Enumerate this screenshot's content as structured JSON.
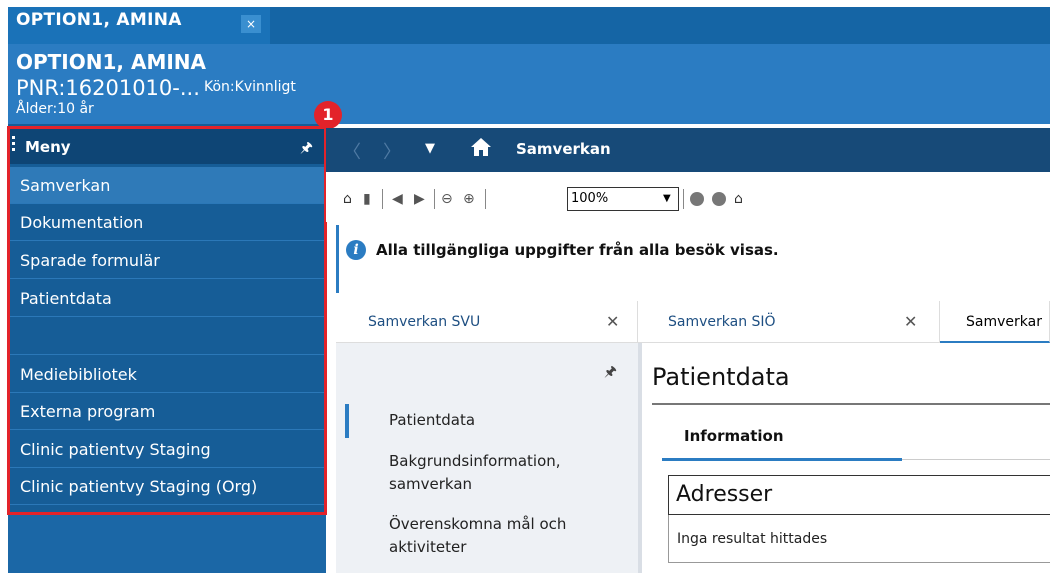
{
  "window": {
    "tab_title": "OPTION1, AMINA",
    "tab_close": "×"
  },
  "patient": {
    "name": "OPTION1, AMINA",
    "pnr": "PNR:16201010-...",
    "gender": "Kön:Kvinnligt",
    "age": "Ålder:10 år"
  },
  "annotation": {
    "badge": "1",
    "color": "#e3232a"
  },
  "menu": {
    "title": "Meny",
    "items": [
      {
        "label": "Samverkan",
        "selected": true
      },
      {
        "label": "Dokumentation"
      },
      {
        "label": "Sparade formulär"
      },
      {
        "label": "Patientdata"
      },
      {
        "label": ""
      },
      {
        "label": "Mediebibliotek"
      },
      {
        "label": "Externa program"
      },
      {
        "label": "Clinic patientvy Staging"
      },
      {
        "label": "Clinic patientvy Staging (Org)"
      }
    ]
  },
  "nav": {
    "title": "Samverkan",
    "icons": [
      "back-icon",
      "forward-icon",
      "dropdown-icon",
      "home-icon"
    ]
  },
  "toolbar": {
    "zoom": "100%",
    "icons": [
      "binoculars-icon",
      "page-icon",
      "prev-page-icon",
      "next-page-icon",
      "zoom-out-icon",
      "zoom-in-icon",
      "circle-icon",
      "circle-icon",
      "home-icon"
    ]
  },
  "info_banner": {
    "text": "Alla tillgängliga uppgifter från alla besök visas."
  },
  "tabs": [
    {
      "label": "Samverkan SVU",
      "close": "✕"
    },
    {
      "label": "Samverkan SIÖ",
      "close": "✕"
    },
    {
      "label": "Samverkar",
      "active": true
    }
  ],
  "nav_panel": {
    "items": [
      "Patientdata",
      "Bakgrundsinformation,",
      "samverkan",
      "Överenskomna mål och",
      "aktiviteter"
    ]
  },
  "patientdata": {
    "title": "Patientdata",
    "tab": "Information",
    "section_title": "Adresser",
    "empty_text": "Inga resultat hittades"
  },
  "colors": {
    "header": "#2b7cc2",
    "sidebar": "#165d97",
    "accent": "#2b7cc2"
  }
}
